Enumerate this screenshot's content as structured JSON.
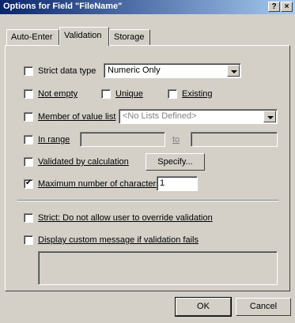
{
  "window": {
    "title": "Options for Field \"FileName\"",
    "help_label": "?",
    "close_label": "×"
  },
  "tabs": [
    {
      "label": "Auto-Enter"
    },
    {
      "label": "Validation"
    },
    {
      "label": "Storage"
    }
  ],
  "validation": {
    "strict_data_type": {
      "label": "Strict data type",
      "checked": false,
      "selected": "Numeric Only"
    },
    "not_empty": {
      "label": "Not empty",
      "checked": false
    },
    "unique": {
      "label": "Unique",
      "checked": false
    },
    "existing": {
      "label": "Existing",
      "checked": false
    },
    "member_of_value_list": {
      "label": "Member of value list",
      "checked": false,
      "selected": "<No Lists Defined>"
    },
    "in_range": {
      "label": "In range",
      "checked": false,
      "from_value": "",
      "to_label": "to",
      "to_value": ""
    },
    "validated_by_calculation": {
      "label": "Validated by calculation",
      "checked": false,
      "button_label": "Specify..."
    },
    "max_chars": {
      "label": "Maximum number of characters",
      "checked": true,
      "value": "1"
    },
    "strict_override": {
      "label": "Strict: Do not allow user to override validation",
      "checked": false
    },
    "custom_message": {
      "label": "Display custom message if validation fails",
      "checked": false,
      "value": ""
    }
  },
  "footer": {
    "ok_label": "OK",
    "cancel_label": "Cancel"
  }
}
